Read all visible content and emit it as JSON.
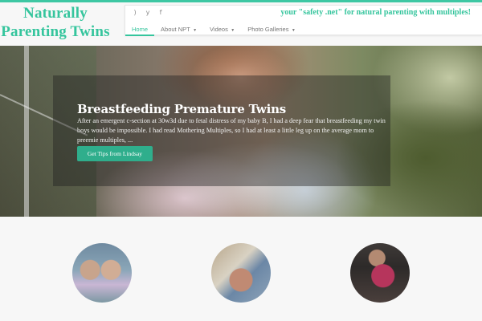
{
  "site": {
    "logo_line1": "Naturally",
    "logo_line2": "Parenting Twins",
    "tagline": "your \"safety .net\" for natural parenting with multiples!",
    "brand_color": "#35c59d"
  },
  "social": [
    {
      "icon": "rss-icon"
    },
    {
      "icon": "twitter-icon"
    },
    {
      "icon": "facebook-icon"
    }
  ],
  "nav": {
    "items": [
      {
        "label": "Home",
        "active": true
      },
      {
        "label": "About NPT",
        "dropdown": true
      },
      {
        "label": "Videos",
        "dropdown": true
      },
      {
        "label": "Photo Galleries",
        "dropdown": true
      }
    ]
  },
  "slide": {
    "title": "Breastfeeding Premature Twins",
    "text": "After an emergent c-section at 30w3d due to fetal distress of my baby B, I had a deep fear that breastfeeding my twin boys would be impossible. I had read Mothering Multiples, so I had at least a little leg up on the average mom to preemie multiples, ...",
    "button": "Get Tips from Lindsay",
    "button_color": "#2fae8c"
  },
  "features": [
    {
      "image": "twins-photo"
    },
    {
      "image": "baby-photo"
    },
    {
      "image": "babywearing-photo"
    }
  ]
}
